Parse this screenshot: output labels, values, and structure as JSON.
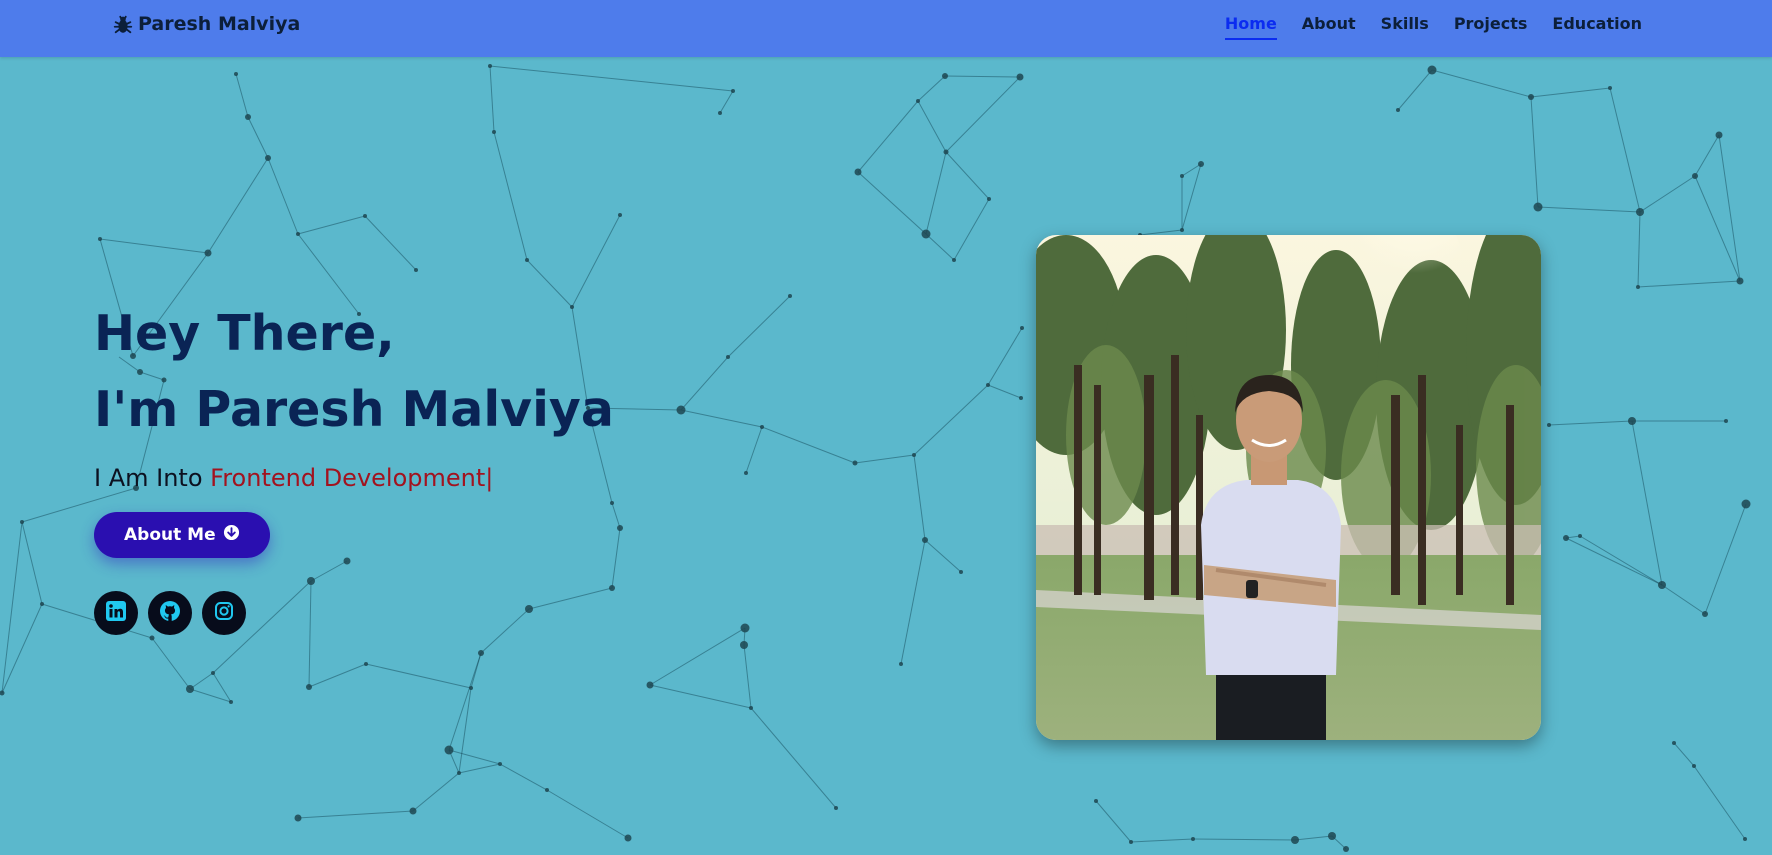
{
  "navbar": {
    "brand": {
      "name": "Paresh Malviya",
      "icon": "bug-icon"
    },
    "links": [
      {
        "label": "Home",
        "active": true
      },
      {
        "label": "About",
        "active": false
      },
      {
        "label": "Skills",
        "active": false
      },
      {
        "label": "Projects",
        "active": false
      },
      {
        "label": "Education",
        "active": false
      }
    ]
  },
  "hero": {
    "greeting": "Hey There,",
    "name_line": "I'm Paresh Malviya",
    "subtitle_prefix": "I Am Into ",
    "subtitle_typed": "Frontend Development",
    "cursor": "|",
    "button_label": "About Me",
    "button_icon": "arrow-circle-down-icon",
    "socials": [
      {
        "icon": "linkedin-icon"
      },
      {
        "icon": "github-icon"
      },
      {
        "icon": "instagram-icon"
      }
    ]
  },
  "profile_photo": {
    "subject": "person-standing-in-park"
  },
  "colors": {
    "background": "#5bb8cc",
    "navbar": "#4e7ceb",
    "heading": "#0a2455",
    "accent_text": "#a2131f",
    "button": "#2a0fb0",
    "active_link": "#0b2cf0",
    "social_icon": "#20c8f0"
  }
}
